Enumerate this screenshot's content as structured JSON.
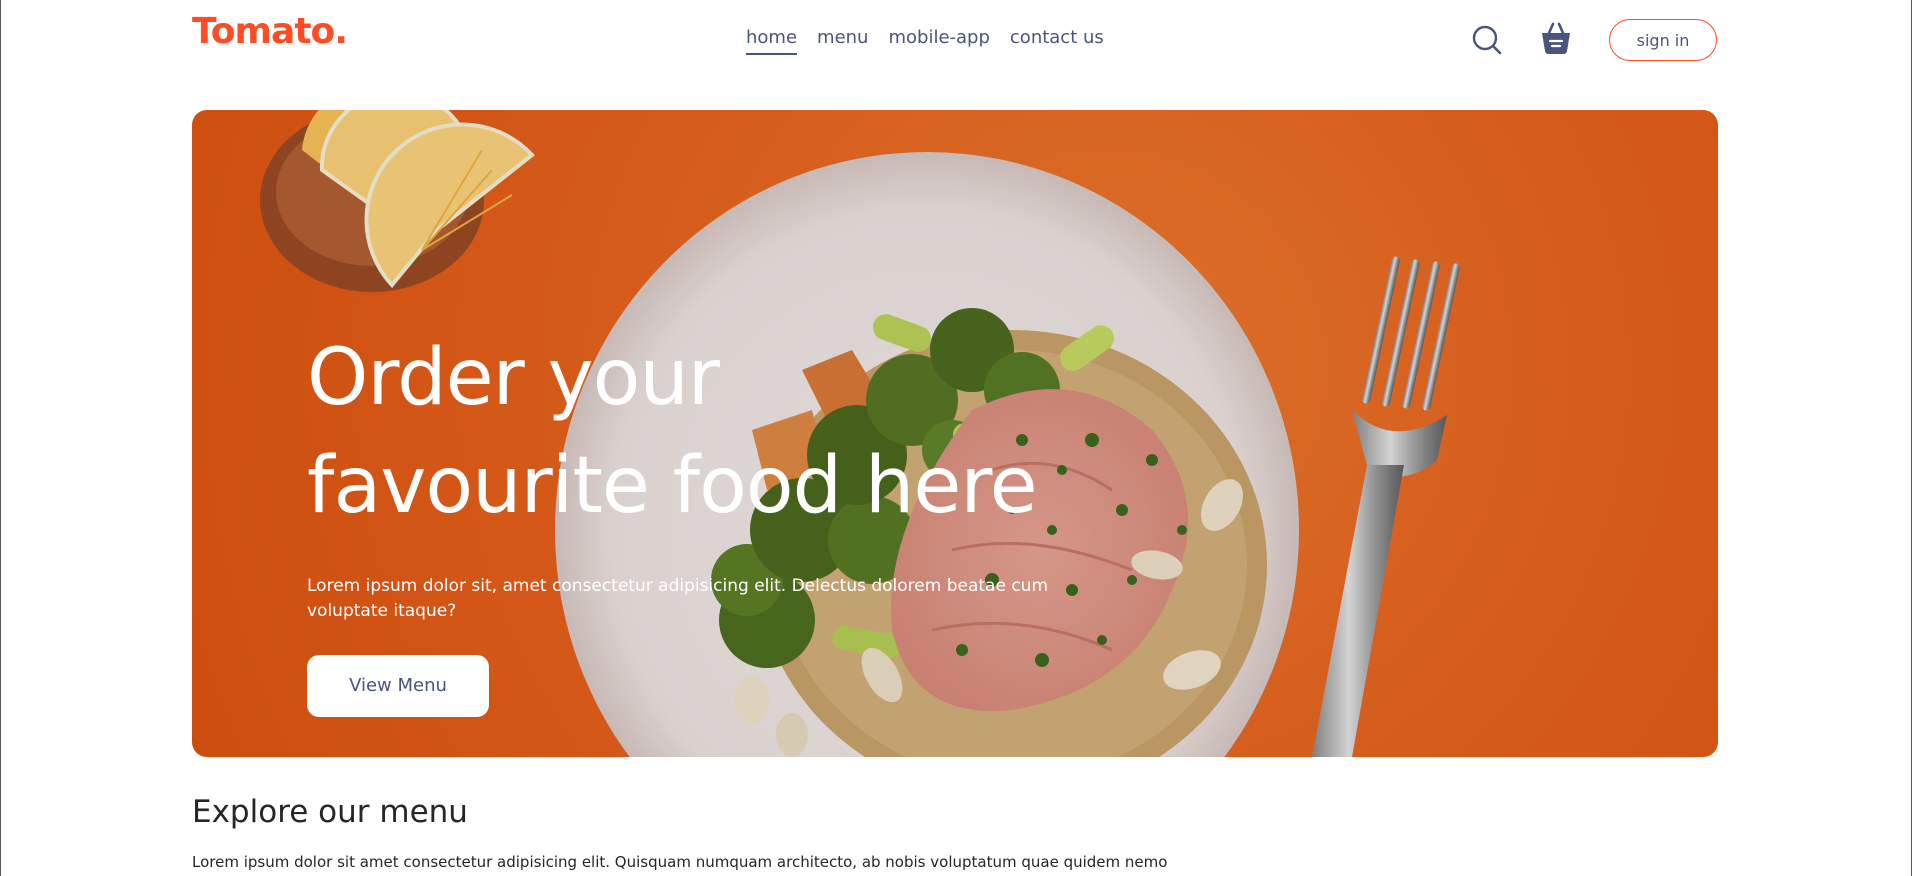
{
  "brand": {
    "logo": "Tomato.",
    "accent_color": "#ff4c24",
    "text_color": "#49557e"
  },
  "nav": {
    "links": [
      {
        "label": "home",
        "active": true
      },
      {
        "label": "menu",
        "active": false
      },
      {
        "label": "mobile-app",
        "active": false
      },
      {
        "label": "contact us",
        "active": false
      }
    ],
    "search_icon": "search-icon",
    "basket_icon": "basket-icon",
    "signin_label": "sign in"
  },
  "hero": {
    "title_line1": "Order your",
    "title_line2": "favourite food here",
    "description": "Lorem ipsum dolor sit, amet consectetur adipisicing elit. Delectus dolorem beatae cum voluptate itaque?",
    "button_label": "View Menu",
    "background_color": "#e9651f"
  },
  "explore": {
    "title": "Explore our menu",
    "text": "Lorem ipsum dolor sit amet consectetur adipisicing elit. Quisquam numquam architecto, ab nobis voluptatum quae quidem nemo"
  }
}
